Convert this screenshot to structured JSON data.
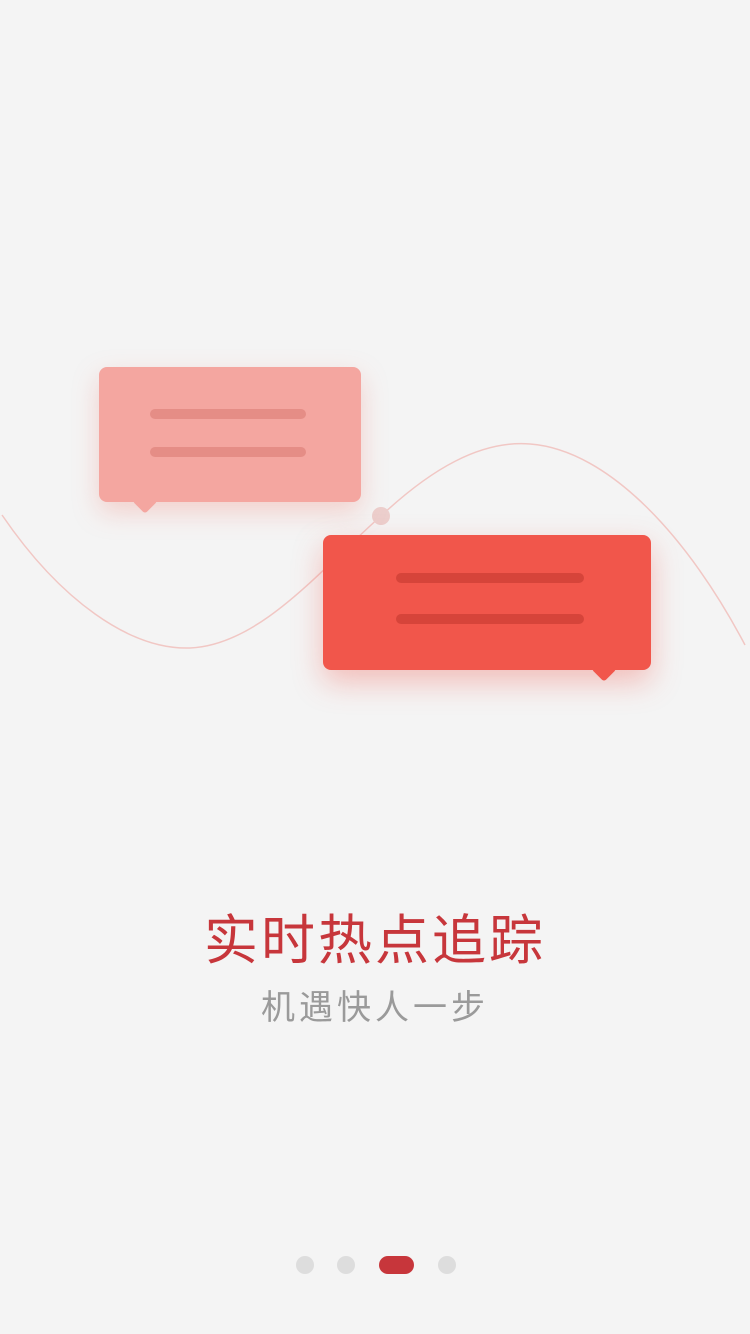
{
  "onboarding": {
    "title": "实时热点追踪",
    "subtitle": "机遇快人一步"
  },
  "pager": {
    "total": 4,
    "active_index": 2
  },
  "colors": {
    "background": "#f4f4f4",
    "accent": "#c7363b",
    "bubble_light": "#f4a6a0",
    "bubble_dark": "#f1564b",
    "subtitle_text": "#9a9a9a",
    "dot_inactive": "#dddddd"
  },
  "icons": {
    "illustration": "chat-bubbles-on-wave-illustration"
  }
}
